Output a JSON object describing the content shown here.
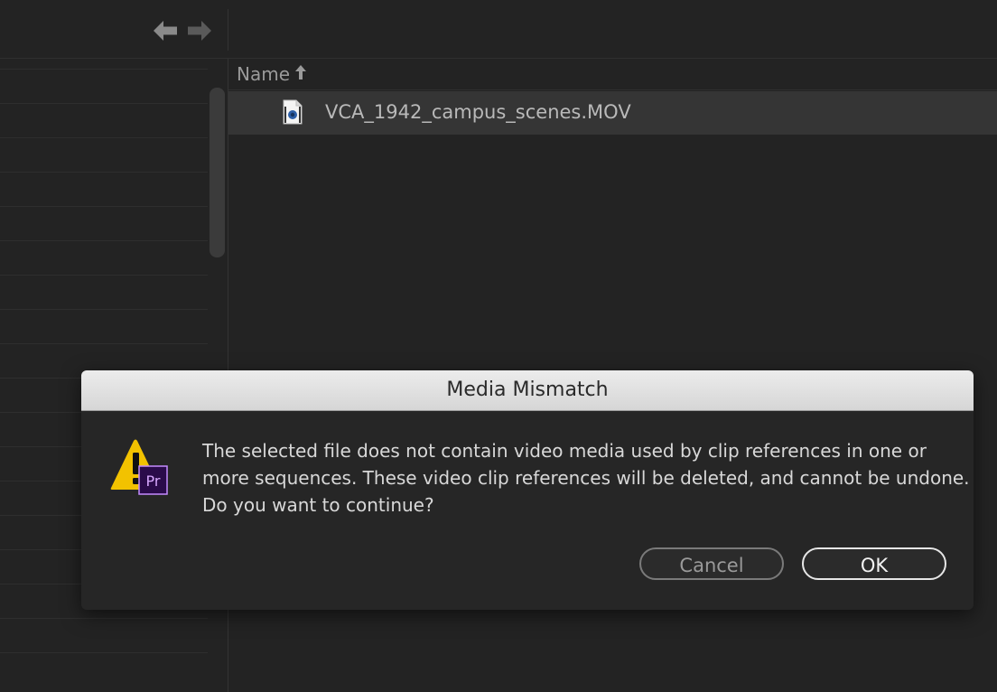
{
  "nav": {
    "back_icon": "arrow-left-icon",
    "forward_icon": "arrow-right-icon"
  },
  "file_list": {
    "column_header": "Name",
    "sort_icon": "sort-ascending-icon",
    "rows": [
      {
        "name": "VCA_1942_campus_scenes.MOV",
        "icon": "video-file-icon"
      }
    ]
  },
  "dialog": {
    "title": "Media Mismatch",
    "icon": "premiere-warning-icon",
    "badge_text": "Pr",
    "message_lines": [
      "The selected file does not contain video media used by clip references in one or",
      "more sequences. These video clip references will be deleted, and cannot be undone.",
      "Do you want to continue?"
    ],
    "cancel_label": "Cancel",
    "ok_label": "OK"
  },
  "colors": {
    "warning_yellow": "#f2c200",
    "premiere_purple": "#2a0b4a",
    "premiere_text": "#d8a8ff"
  }
}
